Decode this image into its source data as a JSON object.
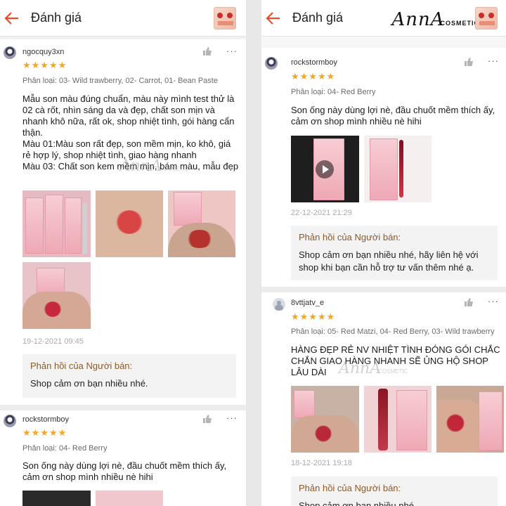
{
  "screen_title": "Đánh giá",
  "brand_watermark": {
    "script": "AnnA",
    "sub": "COSMETIC"
  },
  "seller_reply_title": "Phản hồi của Người bán:",
  "stars": "★★★★★",
  "more": "···",
  "left_reviews": [
    {
      "user": "ngocquy3xn",
      "variant": "Phân loại: 03- Wild trawberry, 02- Carrot, 01- Bean Paste",
      "text": "Mẫu son màu đúng chuẩn, màu này mình test thử là 02 cà rốt, nhìn sáng da và đẹp, chất son mịn và nhanh khô nữa, rất ok, shop nhiệt tình, gói hàng cẩn thận.\n Màu 01:Màu son rất đẹp, son mềm mịn,  ko khô, giá rẻ hợp lý, shop nhiệt tình, giao hàng nhanh\nMàu 03: Chất son kem mềm mịn, bám màu, mẫu đẹp",
      "date": "19-12-2021 09:45",
      "reply": "Shop cảm ơn bạn nhiều nhé."
    },
    {
      "user": "rockstormboy",
      "variant": "Phân loại: 04- Red Berry",
      "text": "Son ống này dùng lợi nè, đầu chuốt mềm thích ấy, cảm ơn shop mình nhiều nè hihi"
    }
  ],
  "right_reviews": [
    {
      "user": "rockstormboy",
      "variant": "Phân loại: 04- Red Berry",
      "text": "Son ống này dùng lợi nè, đầu chuốt mềm thích ấy, cảm ơn shop mình nhiều nè hihi",
      "date": "22-12-2021 21:29",
      "reply": "Shop cảm ơn bạn nhiều nhé, hãy liên hệ với shop khi bạn cần hỗ trợ tư vấn thêm nhé ạ."
    },
    {
      "user": "8vttjatv_e",
      "variant": "Phân loại: 05- Red Matzi, 04- Red Berry, 03- Wild trawberry",
      "text": "HÀNG ĐẸP RẺ NV NHIỆT TÌNH ĐÓNG GÓI CHẮC CHẮN GIAO HÀNG NHANH SẼ ỦNG HỘ SHOP LÂU DÀI",
      "date": "18-12-2021 19:18",
      "reply": "Shop cảm ơn bạn nhiều nhé."
    }
  ],
  "colors": {
    "accent": "#ee4d2d",
    "star": "#f5a623",
    "reply_title": "#8a5a2b"
  }
}
